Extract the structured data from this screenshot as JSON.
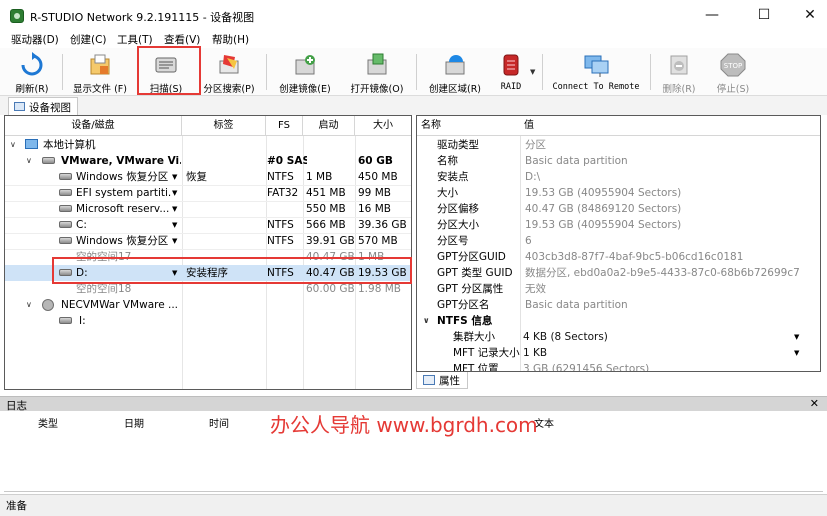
{
  "window": {
    "title": "R-STUDIO Network 9.2.191115 - 设备视图"
  },
  "menu": [
    "驱动器(D)",
    "创建(C)",
    "工具(T)",
    "查看(V)",
    "帮助(H)"
  ],
  "toolbar": {
    "refresh": "刷新(R)",
    "show_files": "显示文件 (F)",
    "scan": "扫描(S)",
    "partition_search": "分区搜索(P)",
    "create_image": "创建镜像(E)",
    "open_image": "打开镜像(O)",
    "create_region": "创建区域(R)",
    "raid": "RAID",
    "connect_remote": "Connect To Remote",
    "delete": "删除(R)",
    "stop": "停止(S)",
    "stop_icon_text": "STOP"
  },
  "tabs": {
    "device_view": "设备视图",
    "properties": "属性"
  },
  "device_grid": {
    "columns": [
      "设备/磁盘",
      "标签",
      "FS",
      "启动",
      "大小"
    ],
    "rows": [
      {
        "name": "本地计算机",
        "label": "",
        "fs": "",
        "start": "",
        "size": ""
      },
      {
        "name": "VMware, VMware Vi...",
        "label": "",
        "fs": "#0 SAS",
        "start": "",
        "size": "60 GB"
      },
      {
        "name": "Windows 恢复分区",
        "label": "恢复",
        "fs": "NTFS",
        "start": "1 MB",
        "size": "450 MB"
      },
      {
        "name": "EFI system partiti...",
        "label": "",
        "fs": "FAT32",
        "start": "451 MB",
        "size": "99 MB"
      },
      {
        "name": "Microsoft reserv...",
        "label": "",
        "fs": "",
        "start": "550 MB",
        "size": "16 MB"
      },
      {
        "name": "C:",
        "label": "",
        "fs": "NTFS",
        "start": "566 MB",
        "size": "39.36 GB"
      },
      {
        "name": "Windows 恢复分区",
        "label": "",
        "fs": "NTFS",
        "start": "39.91 GB",
        "size": "570 MB"
      },
      {
        "name": "空的空间17",
        "label": "",
        "fs": "",
        "start": "40.47 GB",
        "size": "1 MB"
      },
      {
        "name": "D:",
        "label": "安装程序",
        "fs": "NTFS",
        "start": "40.47 GB",
        "size": "19.53 GB"
      },
      {
        "name": "空的空间18",
        "label": "",
        "fs": "",
        "start": "60.00 GB",
        "size": "1.98 MB"
      },
      {
        "name": "NECVMWar VMware ...",
        "label": "",
        "fs": "",
        "start": "",
        "size": ""
      },
      {
        "name": "I:",
        "label": "",
        "fs": "",
        "start": "",
        "size": ""
      }
    ]
  },
  "properties": {
    "columns": [
      "名称",
      "值"
    ],
    "rows": [
      {
        "name": "驱动类型",
        "value": "分区"
      },
      {
        "name": "名称",
        "value": "Basic data partition"
      },
      {
        "name": "安装点",
        "value": "D:\\"
      },
      {
        "name": "大小",
        "value": "19.53 GB (40955904 Sectors)"
      },
      {
        "name": "分区偏移",
        "value": "40.47 GB (84869120 Sectors)"
      },
      {
        "name": "分区大小",
        "value": "19.53 GB (40955904 Sectors)"
      },
      {
        "name": "分区号",
        "value": "6"
      },
      {
        "name": "GPT分区GUID",
        "value": "403cb3d8-87f7-4baf-9bc5-b06cd16c0181"
      },
      {
        "name": "GPT 类型 GUID",
        "value": "数据分区, ebd0a0a2-b9e5-4433-87c0-68b6b72699c7"
      },
      {
        "name": "GPT 分区属性",
        "value": "无效"
      },
      {
        "name": "GPT分区名",
        "value": "Basic data partition"
      }
    ],
    "ntfs_section": "NTFS 信息",
    "ntfs_rows": [
      {
        "name": "集群大小",
        "value": "4 KB (8 Sectors)"
      },
      {
        "name": "MFT 记录大小",
        "value": "1 KB"
      },
      {
        "name": "MFT 位置",
        "value": "3 GB (6291456 Sectors)"
      }
    ]
  },
  "log": {
    "title": "日志",
    "columns": [
      "类型",
      "日期",
      "时间",
      "文本"
    ]
  },
  "status": "准备",
  "watermark": "办公人导航 www.bgrdh.com",
  "colors": {
    "highlight": "#e53935",
    "selection": "#cfe3f7"
  }
}
